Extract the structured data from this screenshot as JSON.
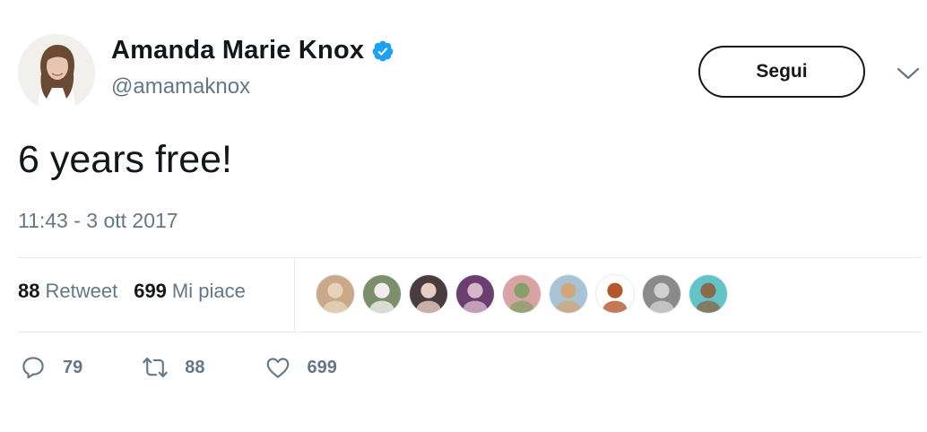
{
  "user": {
    "name": "Amanda Marie Knox",
    "handle": "@amamaknox"
  },
  "follow_button": {
    "label": "Segui"
  },
  "tweet": {
    "text": "6 years free!",
    "timestamp": "11:43 - 3 ott 2017"
  },
  "stats": [
    {
      "count": "88",
      "label": "Retweet"
    },
    {
      "count": "699",
      "label": "Mi piace"
    }
  ],
  "liker_avatars": [
    {
      "bg": "#c9a987",
      "fg": "#e7d3bb"
    },
    {
      "bg": "#7d8f6a",
      "fg": "#f2ecef"
    },
    {
      "bg": "#4a3b3f",
      "fg": "#e6cfc2"
    },
    {
      "bg": "#6a3f70",
      "fg": "#d8b6c9"
    },
    {
      "bg": "#d9a3a3",
      "fg": "#87a06b"
    },
    {
      "bg": "#a6c4d6",
      "fg": "#d2a679"
    },
    {
      "bg": "#ffffff",
      "fg": "#b5572c"
    },
    {
      "bg": "#8a8a8a",
      "fg": "#d0d0d0"
    },
    {
      "bg": "#62c3c9",
      "fg": "#8a6a4a"
    }
  ],
  "actions": {
    "reply_count": "79",
    "retweet_count": "88",
    "like_count": "699"
  },
  "colors": {
    "verified": "#1da1f2",
    "secondary_text": "#657786",
    "primary_text": "#14171a",
    "divider": "#e6ecf0"
  }
}
